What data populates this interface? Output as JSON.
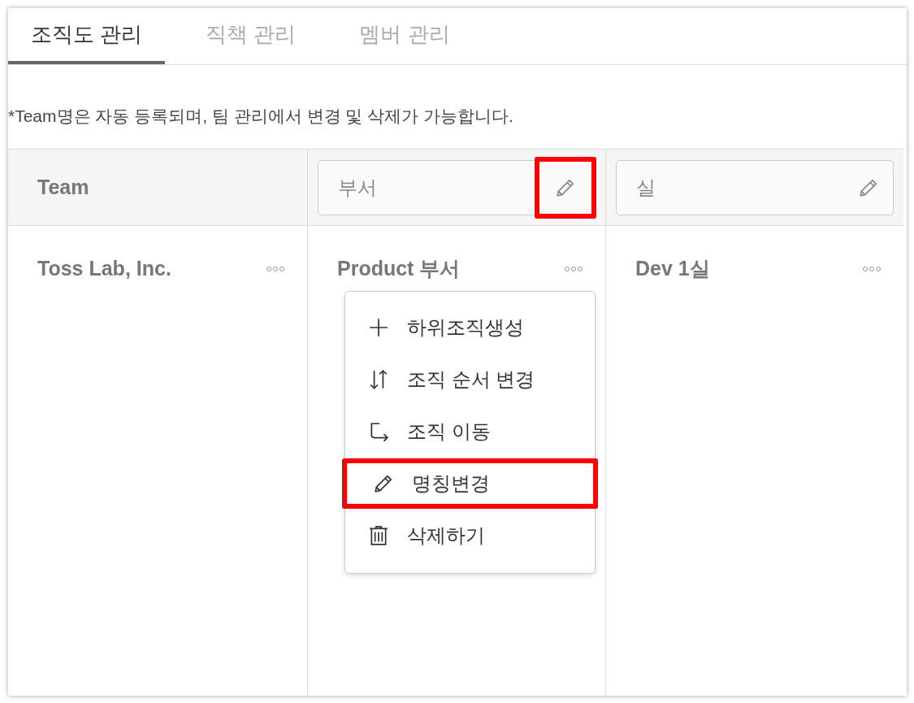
{
  "tabs": [
    {
      "label": "조직도 관리",
      "selected": true
    },
    {
      "label": "직책 관리",
      "selected": false
    },
    {
      "label": "멤버 관리",
      "selected": false
    }
  ],
  "notice": "*Team명은 자동 등록되며, 팀 관리에서 변경 및 삭제가 가능합니다.",
  "columns": [
    {
      "kind": "label",
      "header": "Team",
      "node": "Toss Lab, Inc."
    },
    {
      "kind": "field",
      "header": "부서",
      "edit_highlighted": true,
      "node": "Product 부서",
      "menu": [
        {
          "kind": "plus",
          "label": "하위조직생성",
          "highlighted": false
        },
        {
          "kind": "sort",
          "label": "조직 순서 변경",
          "highlighted": false
        },
        {
          "kind": "move",
          "label": "조직 이동",
          "highlighted": false
        },
        {
          "kind": "pencil",
          "label": "명칭변경",
          "highlighted": true
        },
        {
          "kind": "trash",
          "label": "삭제하기",
          "highlighted": false
        }
      ]
    },
    {
      "kind": "field",
      "header": "실",
      "edit_highlighted": false,
      "node": "Dev 1실"
    }
  ]
}
